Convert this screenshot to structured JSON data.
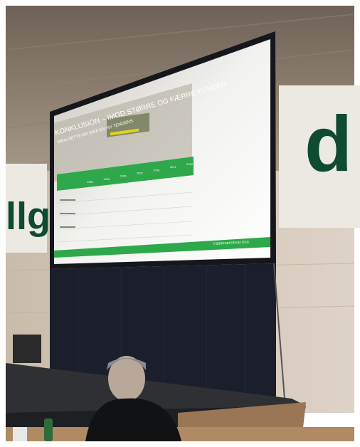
{
  "slide": {
    "title_line1": "KONKLUSION – IMOD STØRRE OG FÆRRE KUNDER",
    "title_line2": "MEN DETTE ER IKKE EN NY TENDENS",
    "years": [
      "1980",
      "1990",
      "1996",
      "2002",
      "2008",
      "2014",
      "2019"
    ],
    "footer_text": "FJERKRÆFORUM 2018"
  },
  "banners": {
    "left_text": "llg",
    "right_text": "d"
  },
  "colors": {
    "slide_green": "#2ea84a",
    "banner_green": "#0f4a33",
    "wall": "#d9cfc1",
    "stage": "#2b2b2b"
  }
}
